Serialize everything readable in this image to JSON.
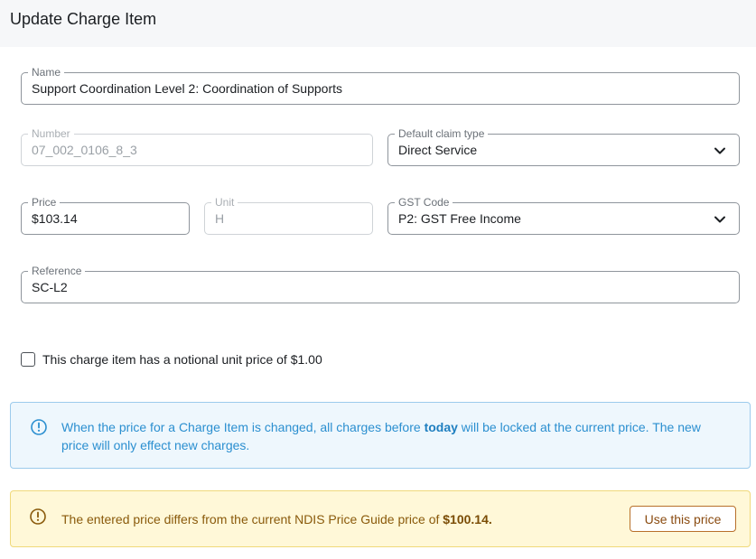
{
  "header": {
    "title": "Update Charge Item"
  },
  "form": {
    "name": {
      "label": "Name",
      "value": "Support Coordination Level 2: Coordination of Supports"
    },
    "number": {
      "label": "Number",
      "value": "07_002_0106_8_3"
    },
    "claim_type": {
      "label": "Default claim type",
      "value": "Direct Service"
    },
    "price": {
      "label": "Price",
      "value": "$103.14"
    },
    "unit": {
      "label": "Unit",
      "value": "H"
    },
    "gst_code": {
      "label": "GST Code",
      "value": "P2: GST Free Income"
    },
    "reference": {
      "label": "Reference",
      "value": "SC-L2"
    },
    "notional_checkbox": {
      "label": "This charge item has a notional unit price of $1.00",
      "checked": false
    }
  },
  "info_alert": {
    "text_before": "When the price for a Charge Item is changed, all charges before ",
    "text_bold": "today",
    "text_after": " will be locked at the current price. The new price will only effect new charges.",
    "color": "#2b8fd0"
  },
  "warning_alert": {
    "text": "The entered price differs from the current NDIS Price Guide price of ",
    "price": "$100.14.",
    "button_label": "Use this price",
    "color": "#8a5a0b"
  }
}
